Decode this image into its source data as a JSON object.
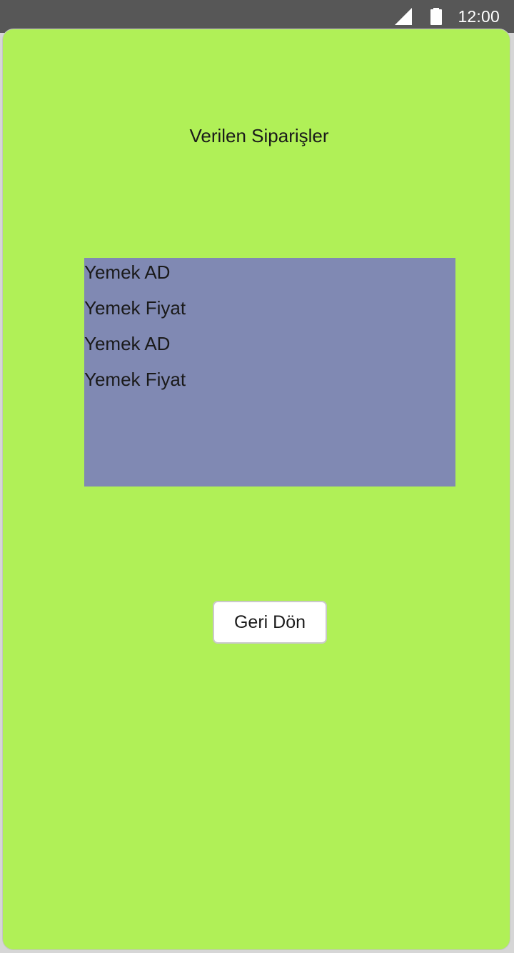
{
  "status_bar": {
    "time": "12:00",
    "icons": [
      "signal-icon",
      "battery-icon"
    ]
  },
  "screen": {
    "title": "Verilen Siparişler",
    "orders": [
      "Yemek AD",
      "Yemek Fiyat",
      "Yemek AD",
      "Yemek Fiyat"
    ],
    "back_button_label": "Geri Dön"
  },
  "colors": {
    "status_bar_bg": "#575757",
    "background": "#b0f057",
    "list_bg": "#8089b3",
    "button_bg": "#ffffff"
  }
}
